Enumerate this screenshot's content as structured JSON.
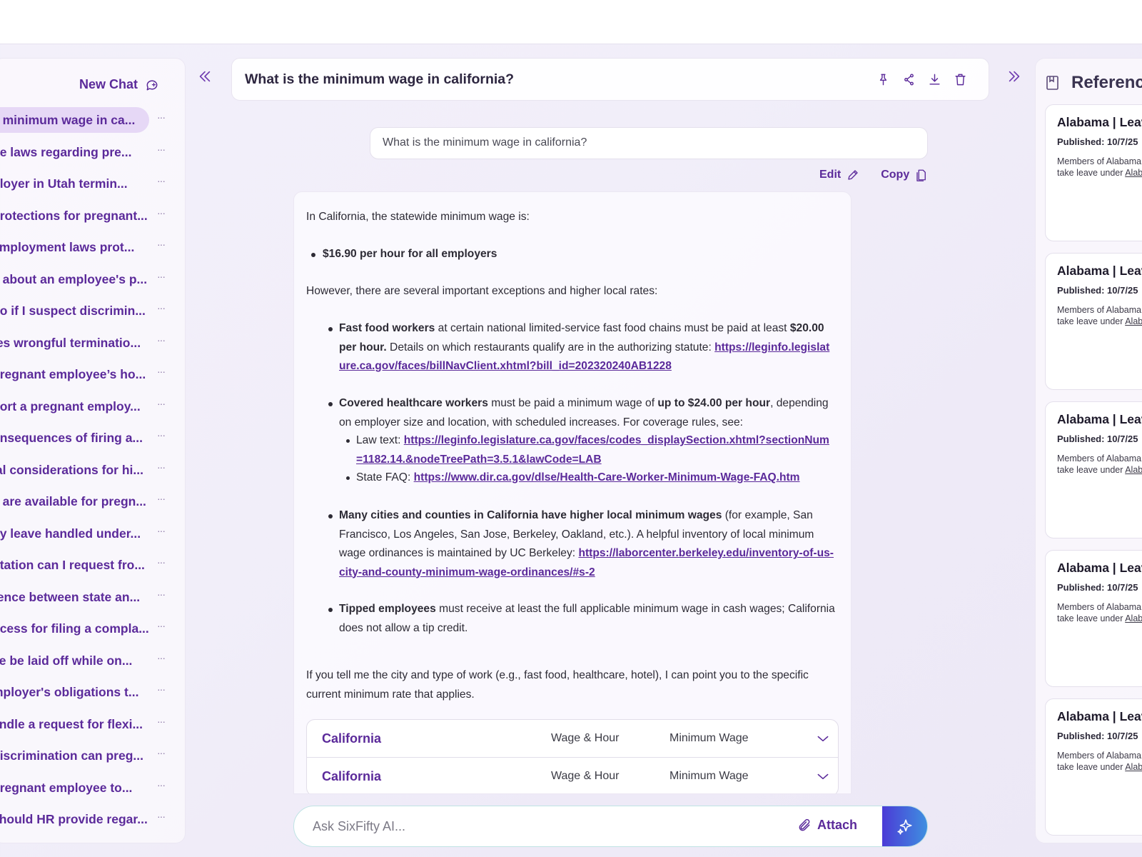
{
  "sidebar": {
    "new_chat": "New Chat",
    "items": [
      {
        "label": "e minimum wage in ca..."
      },
      {
        "label": "he laws regarding pre..."
      },
      {
        "label": "ployer in Utah termin..."
      },
      {
        "label": "protections for pregnant..."
      },
      {
        "label": " employment laws prot..."
      },
      {
        "label": "k about an employee's p..."
      },
      {
        "label": "do if I suspect discrimin..."
      },
      {
        "label": "tes wrongful terminatio..."
      },
      {
        "label": "pregnant employee’s ho..."
      },
      {
        "label": "port a pregnant employ..."
      },
      {
        "label": "onsequences of firing a..."
      },
      {
        "label": "ial considerations for hi..."
      },
      {
        "label": "s are available for pregn..."
      },
      {
        "label": "ity leave handled under..."
      },
      {
        "label": "ntation can I request fro..."
      },
      {
        "label": "rence between state an..."
      },
      {
        "label": "ocess for filing a compla..."
      },
      {
        "label": "ee be laid off while on..."
      },
      {
        "label": "mployer's obligations t..."
      },
      {
        "label": "andle a request for flexi..."
      },
      {
        "label": " discrimination can preg..."
      },
      {
        "label": " pregnant employee to..."
      },
      {
        "label": "should HR provide regar..."
      }
    ],
    "dots": "···"
  },
  "header": {
    "title": "What is the minimum wage in california?"
  },
  "question": {
    "text": "What is the minimum wage in california?",
    "edit": "Edit",
    "copy": "Copy"
  },
  "answer": {
    "intro": "In California, the statewide minimum wage is:",
    "summary": "$16.90 per hour for all employers",
    "however": "However, there are several important exceptions and higher local rates:",
    "fastfood_bold": "Fast food workers",
    "fastfood_text": " at certain national limited-service fast food chains must be paid at least ",
    "fastfood_rate": "$20.00 per hour.",
    "fastfood_text2": " Details on which restaurants qualify are in the authorizing statute: ",
    "fastfood_link": "https://leginfo.legislature.ca.gov/faces/billNavClient.xhtml?bill_id=202320240AB1228",
    "health_bold": "Covered healthcare workers",
    "health_text": " must be paid a minimum wage of ",
    "health_rate": "up to $24.00 per hour",
    "health_text2": ", depending on employer size and location, with scheduled increases. For coverage rules, see:",
    "law_label": "Law text: ",
    "law_link": "https://leginfo.legislature.ca.gov/faces/codes_displaySection.xhtml?sectionNum=1182.14.&nodeTreePath=3.5.1&lawCode=LAB",
    "faq_label": "State FAQ: ",
    "faq_link": "https://www.dir.ca.gov/dlse/Health-Care-Worker-Minimum-Wage-FAQ.htm",
    "cities_bold": "Many cities and counties in California have higher local minimum wages",
    "cities_text": " (for example, San Francisco, Los Angeles, San Jose, Berkeley, Oakland, etc.). A helpful inventory of local minimum wage ordinances is maintained by UC Berkeley: ",
    "cities_link": "https://laborcenter.berkeley.edu/inventory-of-us-city-and-county-minimum-wage-ordinances/#s-2",
    "tipped_bold": "Tipped employees",
    "tipped_text": " must receive at least the full applicable minimum wage in cash wages; California does not allow a tip credit.",
    "closing": "If you tell me the city and type of work (e.g., fast food, healthcare, hotel), I can point you to the specific current minimum rate that applies."
  },
  "ref_rows": [
    {
      "state": "California",
      "category": "Wage & Hour",
      "topic": "Minimum Wage"
    },
    {
      "state": "California",
      "category": "Wage & Hour",
      "topic": "Minimum Wage"
    }
  ],
  "input": {
    "placeholder": "Ask SixFifty AI...",
    "attach": "Attach"
  },
  "references": {
    "title": "References",
    "cards": [
      {
        "title": "Alabama | Leave",
        "published": "Published: 10/7/25",
        "desc1": "Members of Alabama",
        "desc2": "take leave under ",
        "desc_link": "Alab"
      },
      {
        "title": "Alabama | Leave",
        "published": "Published: 10/7/25",
        "desc1": "Members of Alabama",
        "desc2": "take leave under ",
        "desc_link": "Alab"
      },
      {
        "title": "Alabama | Leave",
        "published": "Published: 10/7/25",
        "desc1": "Members of Alabama",
        "desc2": "take leave under ",
        "desc_link": "Alab"
      },
      {
        "title": "Alabama | Leave",
        "published": "Published: 10/7/25",
        "desc1": "Members of Alabama",
        "desc2": "take leave under ",
        "desc_link": "Alab"
      },
      {
        "title": "Alabama | Leave",
        "published": "Published: 10/7/25",
        "desc1": "Members of Alabama",
        "desc2": "take leave under ",
        "desc_link": "Alab"
      }
    ]
  },
  "colors": {
    "accent": "#5b2a9a",
    "active_chat": "#e6d8f6",
    "send_gradient_start": "#4b3bd6",
    "send_gradient_end": "#3f8fe0"
  }
}
